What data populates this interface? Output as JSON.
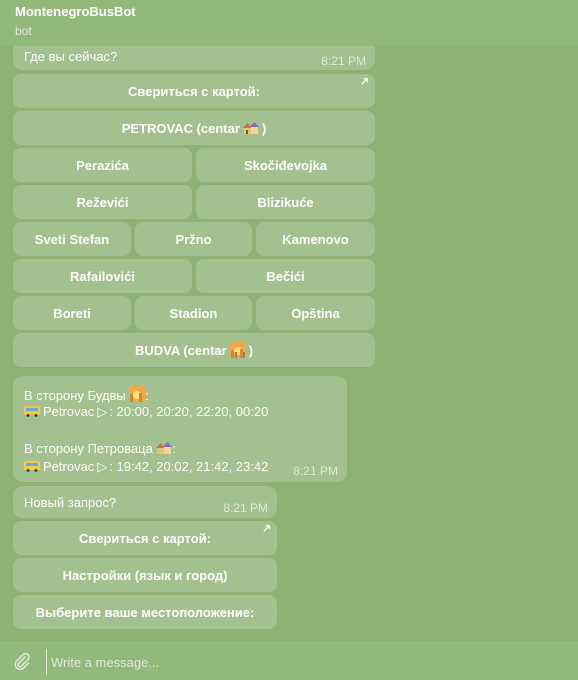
{
  "header": {
    "title": "MontenegroBusBot",
    "subtitle": "bot"
  },
  "message1": {
    "text": "Где вы сейчас?",
    "time": "8:21 PM"
  },
  "keyboard1": {
    "map_button": "Свериться с картой:",
    "petrovac": "PETROVAC (centar",
    "petrovac_close": ")",
    "perazica": "Perazića",
    "skocidjevojka": "Skočiđevojka",
    "rezevici": "Reževići",
    "blizikuce": "Blizikuće",
    "sveti_stefan": "Sveti Stefan",
    "przno": "Pržno",
    "kamenovo": "Kamenovo",
    "rafailovici": "Rafailovići",
    "becici": "Bečići",
    "boreti": "Boreti",
    "stadion": "Stadion",
    "opstina": "Opština",
    "budva": "BUDVA (centar",
    "budva_close": ")"
  },
  "message2": {
    "line1": "В сторону Будвы",
    "line1_suffix": ":",
    "line2_stop": "Petrovac",
    "line2_times": ": 20:00,  20:20,  22:20,  00:20",
    "line3": "В сторону Петроваца",
    "line3_suffix": ":",
    "line4_stop": "Petrovac",
    "line4_times": ": 19:42,  20:02,  21:42,  23:42",
    "time": "8:21 PM",
    "play_symbol": "▷"
  },
  "message3": {
    "text": "Новый запрос?",
    "time": "8:21 PM"
  },
  "keyboard2": {
    "map_button": "Свериться с картой:",
    "settings_button": "Настройки (язык и город)",
    "location_button": "Выберите ваше местоположение:"
  },
  "composer": {
    "placeholder": "Write a message..."
  },
  "icons": {
    "attach": "paperclip-icon",
    "link": "arrow-up-right-icon",
    "petrovac_emoji": "houses-icon",
    "budva_emoji": "sunset-city-icon",
    "bus": "bus-icon"
  },
  "colors": {
    "background": "#8eb276",
    "bubble": "#a2c18e",
    "header": "#93b87c"
  }
}
